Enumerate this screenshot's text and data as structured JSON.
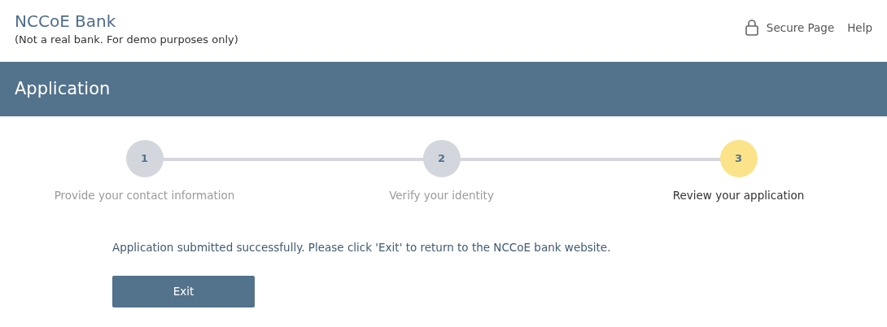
{
  "header": {
    "title": "NCCoE Bank",
    "subtitle": "(Not a real bank. For demo purposes only)",
    "links": [
      "Secure Page",
      "Help"
    ]
  },
  "banner": {
    "title": "Application"
  },
  "steps": [
    {
      "number": "1",
      "label": "Provide your contact information",
      "active": false
    },
    {
      "number": "2",
      "label": "Verify your identity",
      "active": false
    },
    {
      "number": "3",
      "label": "Review your application",
      "active": true
    }
  ],
  "message": "Application submitted successfully. Please click 'Exit' to return to the NCCoE bank website.",
  "button": "Exit"
}
